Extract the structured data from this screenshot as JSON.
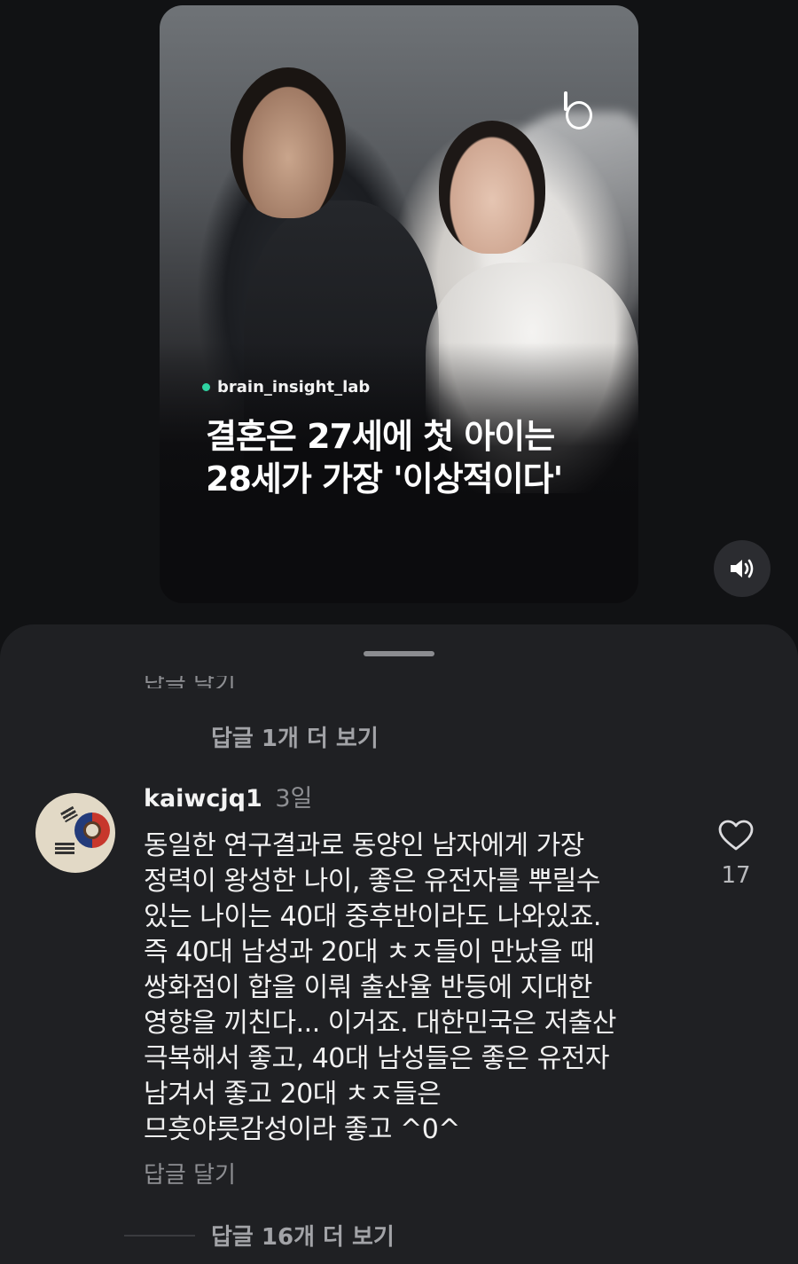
{
  "reel": {
    "channel_name": "brain_insight_lab",
    "headline_line1": "결혼은 27세에 첫 아이는",
    "headline_line2": "28세가 가장 '이상적이다'",
    "sound_icon": "speaker-on-icon"
  },
  "comments": {
    "truncated_text": "답글 달기",
    "more_replies_top": "답글 1개 더 보기",
    "comment": {
      "username": "kaiwcjq1",
      "time": "3일",
      "body": "동일한 연구결과로 동양인 남자에게 가장\n정력이 왕성한 나이, 좋은 유전자를 뿌릴수\n있는 나이는 40대 중후반이라도 나와있죠.\n즉 40대 남성과 20대 ㅊㅈ들이 만났을 때\n쌍화점이 합을 이뤄 출산율 반등에 지대한\n영향을 끼친다... 이거죠. 대한민국은 저출산\n극복해서 좋고, 40대 남성들은 좋은 유전자\n남겨서 좋고 20대 ㅊㅈ들은\n므흣야릇감성이라 좋고 ^0^",
      "reply_label": "답글 달기",
      "like_count": "17",
      "like_icon": "heart-outline-icon"
    },
    "more_replies_bottom": "답글 16개 더 보기"
  }
}
